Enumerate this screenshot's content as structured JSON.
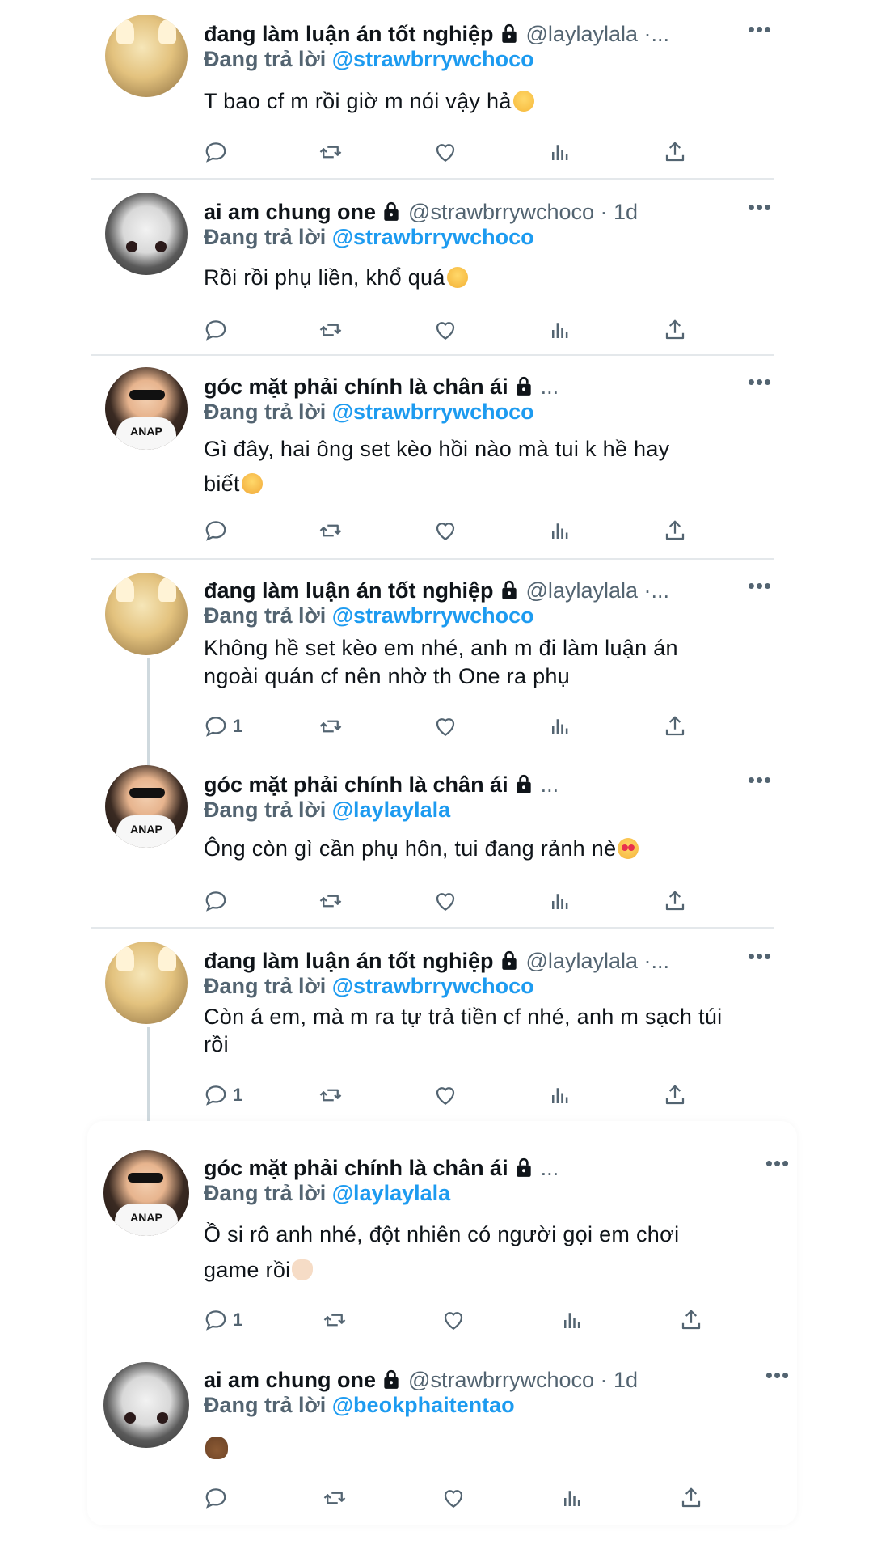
{
  "tweets": [
    {
      "display_name": "đang làm luận án tốt nghiệp",
      "handle": "@laylaylala ·...",
      "replying_prefix": "Đang trả lời",
      "replying_to": "@strawbrrywchoco",
      "text": "T bao cf m rồi giờ m nói vậy hả",
      "emoji": "raised-eyebrow-emoji",
      "reply_count": ""
    },
    {
      "display_name": "ai am chung one",
      "handle": "@strawbrrywchoco · 1d",
      "replying_prefix": "Đang trả lời",
      "replying_to": "@strawbrrywchoco",
      "text": "Rồi rồi phụ liền, khổ quá",
      "emoji": "hushed-face-emoji",
      "reply_count": ""
    },
    {
      "display_name": "góc mặt phải chính là chân ái",
      "handle": "...",
      "replying_prefix": "Đang trả lời",
      "replying_to": "@strawbrrywchoco",
      "text": "Gì đây, hai ông set kèo hồi nào mà tui k hề hay biết",
      "emoji": "woozy-face-emoji",
      "reply_count": ""
    },
    {
      "display_name": "đang làm luận án tốt nghiệp",
      "handle": "@laylaylala ·...",
      "replying_prefix": "Đang trả lời",
      "replying_to": "@strawbrrywchoco",
      "text": "Không hề set kèo em nhé, anh m đi làm luận án ngoài quán cf nên nhờ th One ra phụ",
      "emoji": "",
      "reply_count": "1"
    },
    {
      "display_name": "góc mặt phải chính là chân ái",
      "handle": "...",
      "replying_prefix": "Đang trả lời",
      "replying_to": "@laylaylala",
      "text": "Ông còn gì cần phụ hôn, tui đang rảnh nè",
      "emoji": "heart-eyes-emoji",
      "reply_count": ""
    },
    {
      "display_name": "đang làm luận án tốt nghiệp",
      "handle": "@laylaylala ·...",
      "replying_prefix": "Đang trả lời",
      "replying_to": "@strawbrrywchoco",
      "text": "Còn á em, mà m ra tự trả tiền cf nhé, anh m sạch túi rồi",
      "emoji": "",
      "reply_count": "1"
    },
    {
      "display_name": "góc mặt phải chính là chân ái",
      "handle": "...",
      "replying_prefix": "Đang trả lời",
      "replying_to": "@laylaylala",
      "text": "Ồ si rô anh nhé, đột nhiên có người gọi em chơi game rồi",
      "emoji": "waving-hand-emoji",
      "reply_count": "1"
    },
    {
      "display_name": "ai am chung one",
      "handle": "@strawbrrywchoco · 1d",
      "replying_prefix": "Đang trả lời",
      "replying_to": "@beokphaitentao",
      "text": "",
      "emoji": "pile-of-poo-emoji",
      "reply_count": ""
    }
  ],
  "icons": {
    "reply": "reply-icon",
    "retweet": "retweet-icon",
    "like": "like-icon",
    "views": "views-icon",
    "share": "share-icon",
    "lock": "lock-icon",
    "more": "more-icon"
  },
  "colors": {
    "mention": "#1d9bf0",
    "secondary": "#536471",
    "text": "#0f1419",
    "divider": "#e4e8eb",
    "thread_line": "#cfd9de"
  }
}
